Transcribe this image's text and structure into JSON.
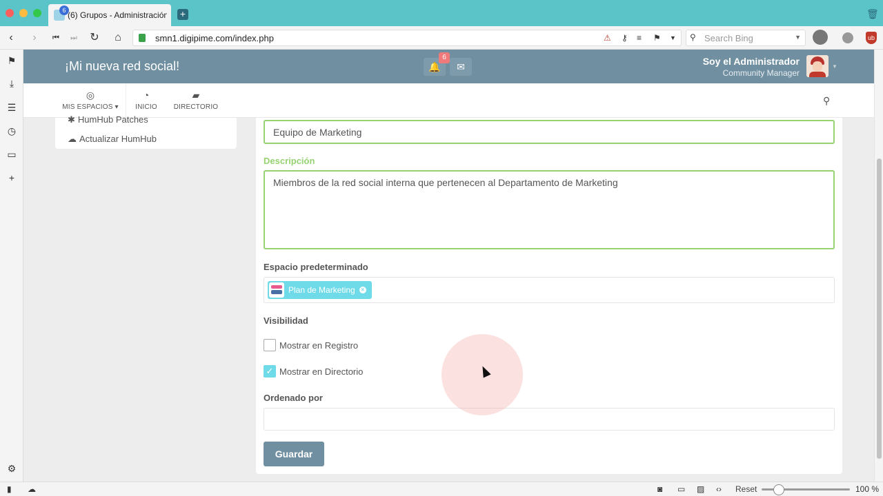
{
  "browser": {
    "tab_title": "(6) Grupos - Administración",
    "tab_badge": "6",
    "url": "smn1.digipime.com/index.php",
    "search_placeholder": "Search Bing",
    "zoom_reset": "Reset",
    "zoom_level": "100 %"
  },
  "app": {
    "title": "¡Mi nueva red social!",
    "notifications_count": "6",
    "user_name": "Soy el Administrador",
    "user_role": "Community Manager"
  },
  "menu": {
    "items": [
      {
        "label": "MIS ESPACIOS",
        "icon": "target-icon"
      },
      {
        "label": "INICIO",
        "icon": "dashboard-icon"
      },
      {
        "label": "DIRECTORIO",
        "icon": "book-icon"
      }
    ]
  },
  "left_panel": {
    "items": [
      {
        "label": "HumHub Patches",
        "icon": "bug-icon"
      },
      {
        "label": "Actualizar HumHub",
        "icon": "cloud-download-icon"
      }
    ]
  },
  "form": {
    "name_value": "Equipo de Marketing",
    "description_label": "Descripción",
    "description_value": "Miembros de la red social interna que pertenecen al Departamento de Marketing",
    "default_space_label": "Espacio predeterminado",
    "default_space_chip": "Plan de Marketing",
    "visibility_label": "Visibilidad",
    "show_registration_label": "Mostrar en Registro",
    "show_registration_checked": false,
    "show_directory_label": "Mostrar en Directorio",
    "show_directory_checked": true,
    "sort_label": "Ordenado por",
    "sort_value": "",
    "save_label": "Guardar"
  },
  "colors": {
    "header": "#708fa0",
    "accent": "#6fdbe8",
    "valid": "#97d271",
    "badge": "#f07a7a"
  }
}
